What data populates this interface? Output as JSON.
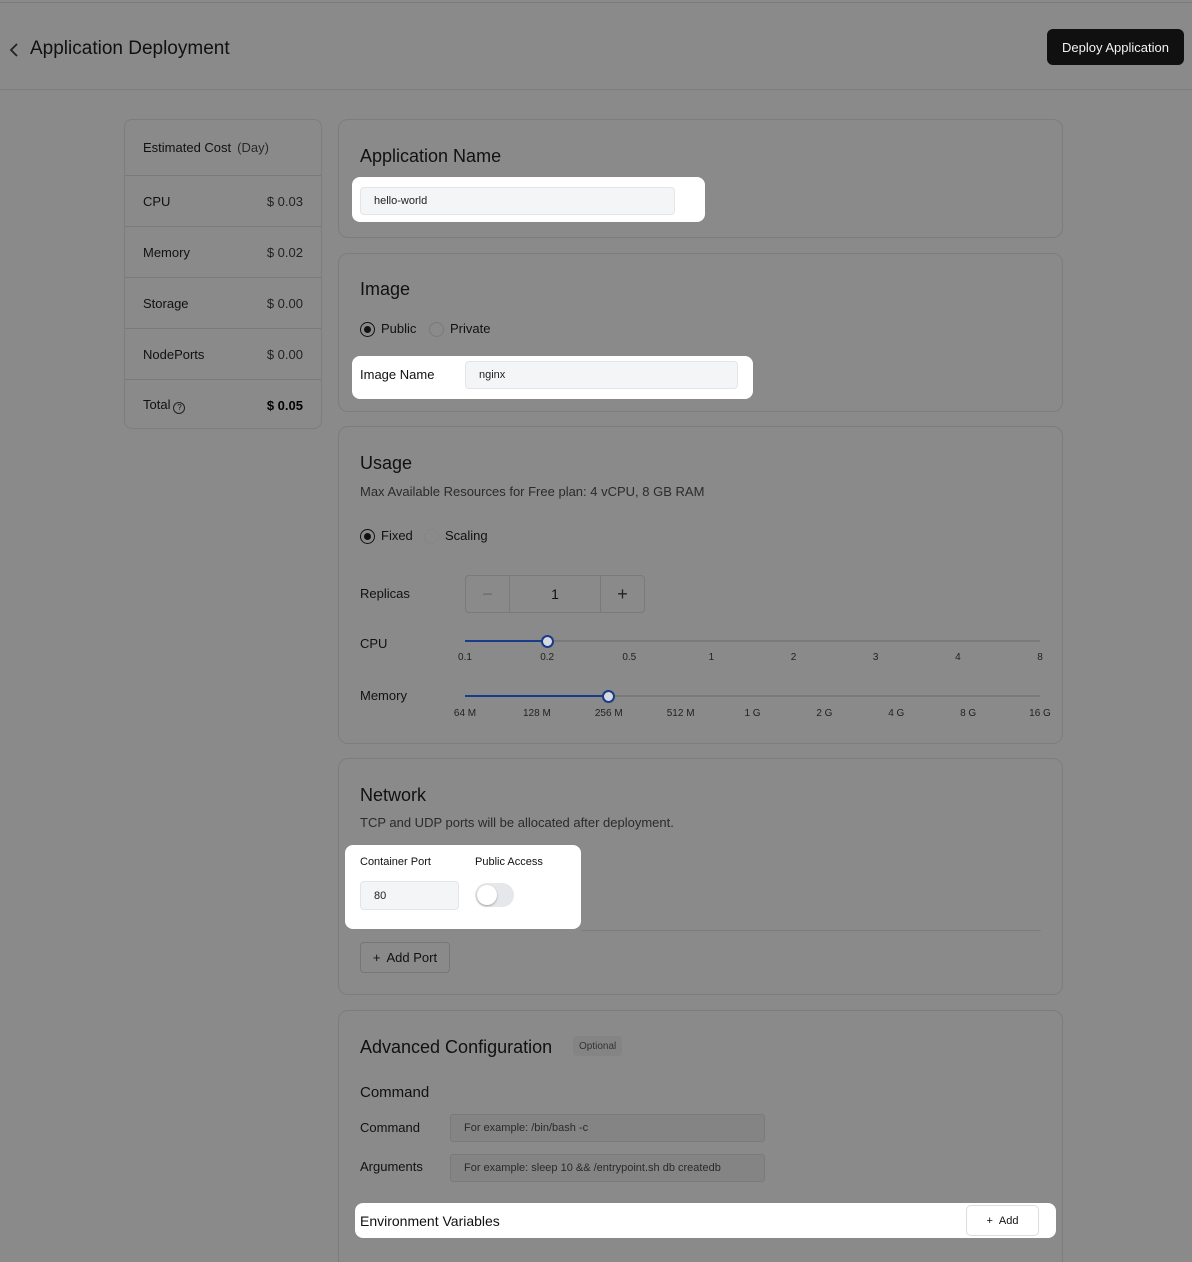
{
  "header": {
    "title": "Application Deployment",
    "deploy_label": "Deploy Application"
  },
  "cost": {
    "heading": "Estimated Cost",
    "period": "(Day)",
    "rows": [
      {
        "label": "CPU",
        "value": "$ 0.03"
      },
      {
        "label": "Memory",
        "value": "$ 0.02"
      },
      {
        "label": "Storage",
        "value": "$ 0.00"
      },
      {
        "label": "NodePorts",
        "value": "$ 0.00"
      }
    ],
    "total_label": "Total",
    "total_value": "$ 0.05",
    "help_glyph": "?"
  },
  "app_name": {
    "title": "Application Name",
    "value": "hello-world"
  },
  "image": {
    "title": "Image",
    "option_public": "Public",
    "option_private": "Private",
    "selected": "Public",
    "name_label": "Image Name",
    "name_value": "nginx"
  },
  "usage": {
    "title": "Usage",
    "subtitle": "Max Available Resources for Free plan: 4 vCPU, 8 GB RAM",
    "option_fixed": "Fixed",
    "option_scaling": "Scaling",
    "selected": "Fixed",
    "replicas_label": "Replicas",
    "replicas_value": "1",
    "minus_glyph": "−",
    "plus_glyph": "+",
    "cpu_label": "CPU",
    "cpu_ticks": [
      "0.1",
      "0.2",
      "0.5",
      "1",
      "2",
      "3",
      "4",
      "8"
    ],
    "cpu_selected": "0.2",
    "memory_label": "Memory",
    "memory_ticks": [
      "64 M",
      "128 M",
      "256 M",
      "512 M",
      "1 G",
      "2 G",
      "4 G",
      "8 G",
      "16 G"
    ],
    "memory_selected": "256 M"
  },
  "network": {
    "title": "Network",
    "subtitle": "TCP and UDP ports will be allocated after deployment.",
    "port_label": "Container Port",
    "port_value": "80",
    "public_label": "Public Access",
    "public_enabled": false,
    "add_port_label": "Add Port",
    "plus_glyph": "+"
  },
  "advanced": {
    "title": "Advanced Configuration",
    "badge": "Optional",
    "command_section": "Command",
    "command_label": "Command",
    "command_placeholder": "For example:  /bin/bash -c",
    "arguments_label": "Arguments",
    "arguments_placeholder": "For example:  sleep 10 && /entrypoint.sh db createdb",
    "env_label": "Environment Variables",
    "env_add_label": "Add",
    "plus_glyph": "+"
  },
  "colors": {
    "accent": "#1a3a8a",
    "deploy_button": "#101010"
  }
}
